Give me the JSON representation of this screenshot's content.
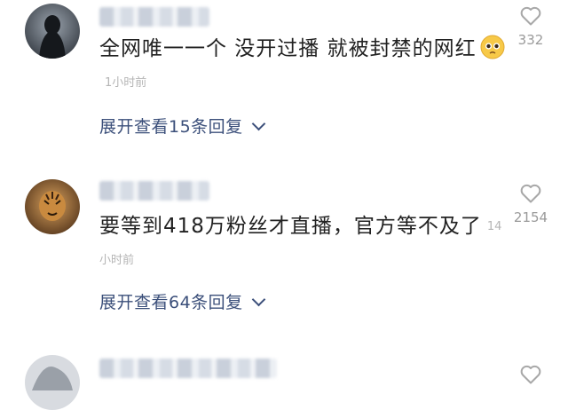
{
  "comments": [
    {
      "text": "全网唯一一个  没开过播 就被封禁的网红",
      "time": "1小时前",
      "likes": "332",
      "expand_label": "展开查看15条回复"
    },
    {
      "text": "要等到418万粉丝才直播，官方等不及了",
      "time": "14小时前",
      "likes": "2154",
      "expand_label": "展开查看64条回复"
    }
  ],
  "icons": {
    "like": "heart-outline-icon",
    "expand": "chevron-down-icon",
    "emoji": "pleading-face-emoji"
  },
  "colors": {
    "link": "#3b4f7a",
    "muted": "#b5b5b5",
    "text": "#222222"
  }
}
